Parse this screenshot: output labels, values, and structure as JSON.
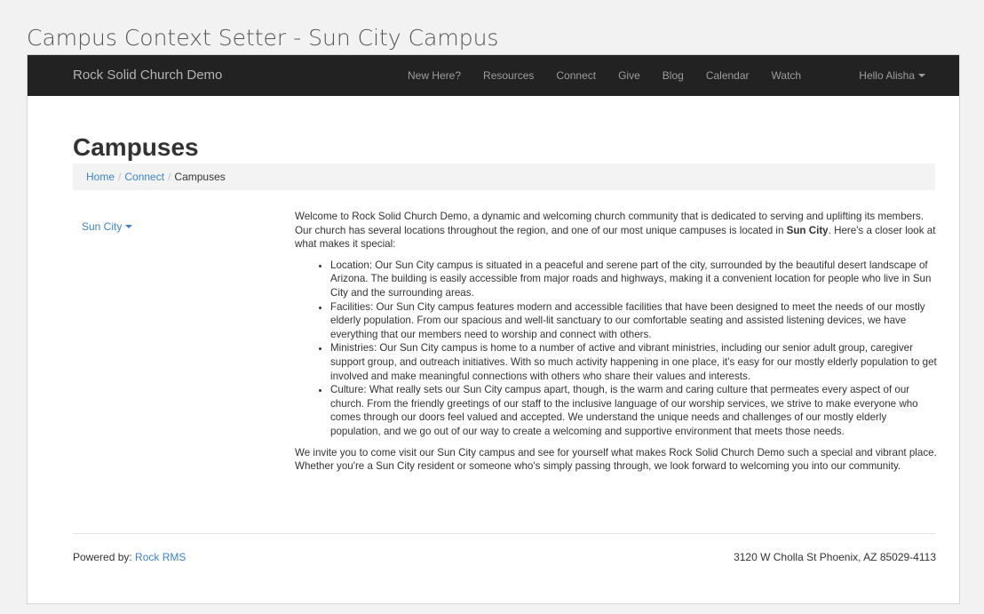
{
  "caption": "Campus Context Setter - Sun City Campus",
  "navbar": {
    "brand": "Rock Solid Church Demo",
    "links": [
      "New Here?",
      "Resources",
      "Connect",
      "Give",
      "Blog",
      "Calendar",
      "Watch"
    ],
    "user": "Hello Alisha"
  },
  "page": {
    "title": "Campuses",
    "breadcrumb": [
      "Home",
      "Connect",
      "Campuses"
    ],
    "campus_picker": "Sun City"
  },
  "content": {
    "intro_pre": "Welcome to Rock Solid Church Demo, a dynamic and welcoming church community that is dedicated to serving and uplifting its members. Our church has several locations throughout the region, and one of our most unique campuses is located in ",
    "intro_bold": "Sun City",
    "intro_post": ". Here's a closer look at what makes it special:",
    "bullets": [
      "Location: Our Sun City campus is situated in a peaceful and serene part of the city, surrounded by the beautiful desert landscape of Arizona. The building is easily accessible from major roads and highways, making it a convenient location for people who live in Sun City and the surrounding areas.",
      "Facilities: Our Sun City campus features modern and accessible facilities that have been designed to meet the needs of our mostly elderly population. From our spacious and well-lit sanctuary to our comfortable seating and assisted listening devices, we have everything that our members need to worship and connect with others.",
      "Ministries: Our Sun City campus is home to a number of active and vibrant ministries, including our senior adult group, caregiver support group, and outreach initiatives. With so much activity happening in one place, it's easy for our mostly elderly population to get involved and make meaningful connections with others who share their values and interests.",
      "Culture: What really sets our Sun City campus apart, though, is the warm and caring culture that permeates every aspect of our church. From the friendly greetings of our staff to the inclusive language of our worship services, we strive to make everyone who comes through our doors feel valued and accepted. We understand the unique needs and challenges of our mostly elderly population, and we go out of our way to create a welcoming and supportive environment that meets those needs."
    ],
    "closing": "We invite you to come visit our Sun City campus and see for yourself what makes Rock Solid Church Demo such a special and vibrant place. Whether you're a Sun City resident or someone who's simply passing through, we look forward to welcoming you into our community."
  },
  "footer": {
    "powered_label": "Powered by: ",
    "powered_link": "Rock RMS",
    "address": "3120 W Cholla St Phoenix, AZ 85029-4113"
  },
  "colors": {
    "navbar_bg": "#222222",
    "link": "#3e83c7",
    "breadcrumb_bg": "#f3f3f3"
  }
}
